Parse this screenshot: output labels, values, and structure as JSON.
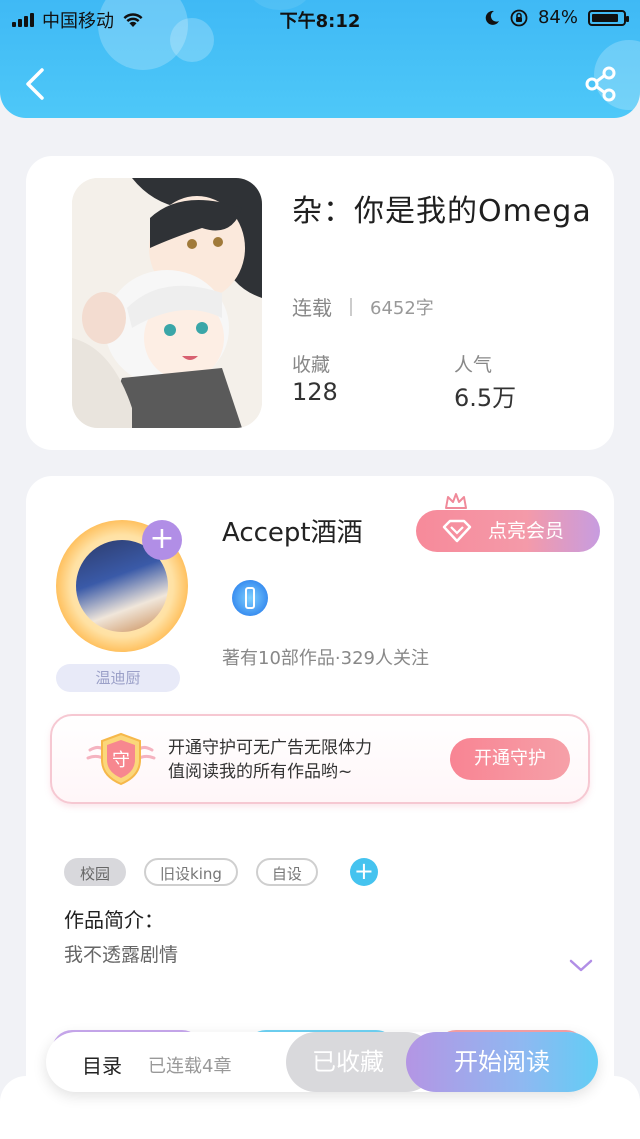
{
  "status_bar": {
    "carrier": "中国移动",
    "time": "下午8:12",
    "battery": "84%"
  },
  "header": {
    "back_icon": "chevron-left-icon",
    "share_icon": "share-icon"
  },
  "book": {
    "title": "杂：你是我的Omega",
    "status": "连载",
    "word_count": "6452字",
    "favorites_label": "收藏",
    "favorites_value": "128",
    "popularity_label": "人气",
    "popularity_value": "6.5万"
  },
  "author": {
    "name": "Accept酒酒",
    "tag": "温迪厨",
    "vip_button": "点亮会员",
    "stats": "著有10部作品·329人关注"
  },
  "guard": {
    "shield_char": "守",
    "line1": "开通守护可无广告无限体力",
    "line2": "值阅读我的所有作品哟~",
    "button": "开通守护"
  },
  "tags": [
    "校园",
    "旧设king",
    "自设"
  ],
  "intro": {
    "heading": "作品简介：",
    "text": "我不透露剧情"
  },
  "bottom": {
    "toc": "目录",
    "chapters": "已连载4章",
    "favorited": "已收藏",
    "read": "开始阅读"
  },
  "colors": {
    "header": "#3fb9f5",
    "accent_purple": "#b18ee6",
    "accent_pink": "#f78a9a",
    "accent_cyan": "#45c3ef"
  }
}
